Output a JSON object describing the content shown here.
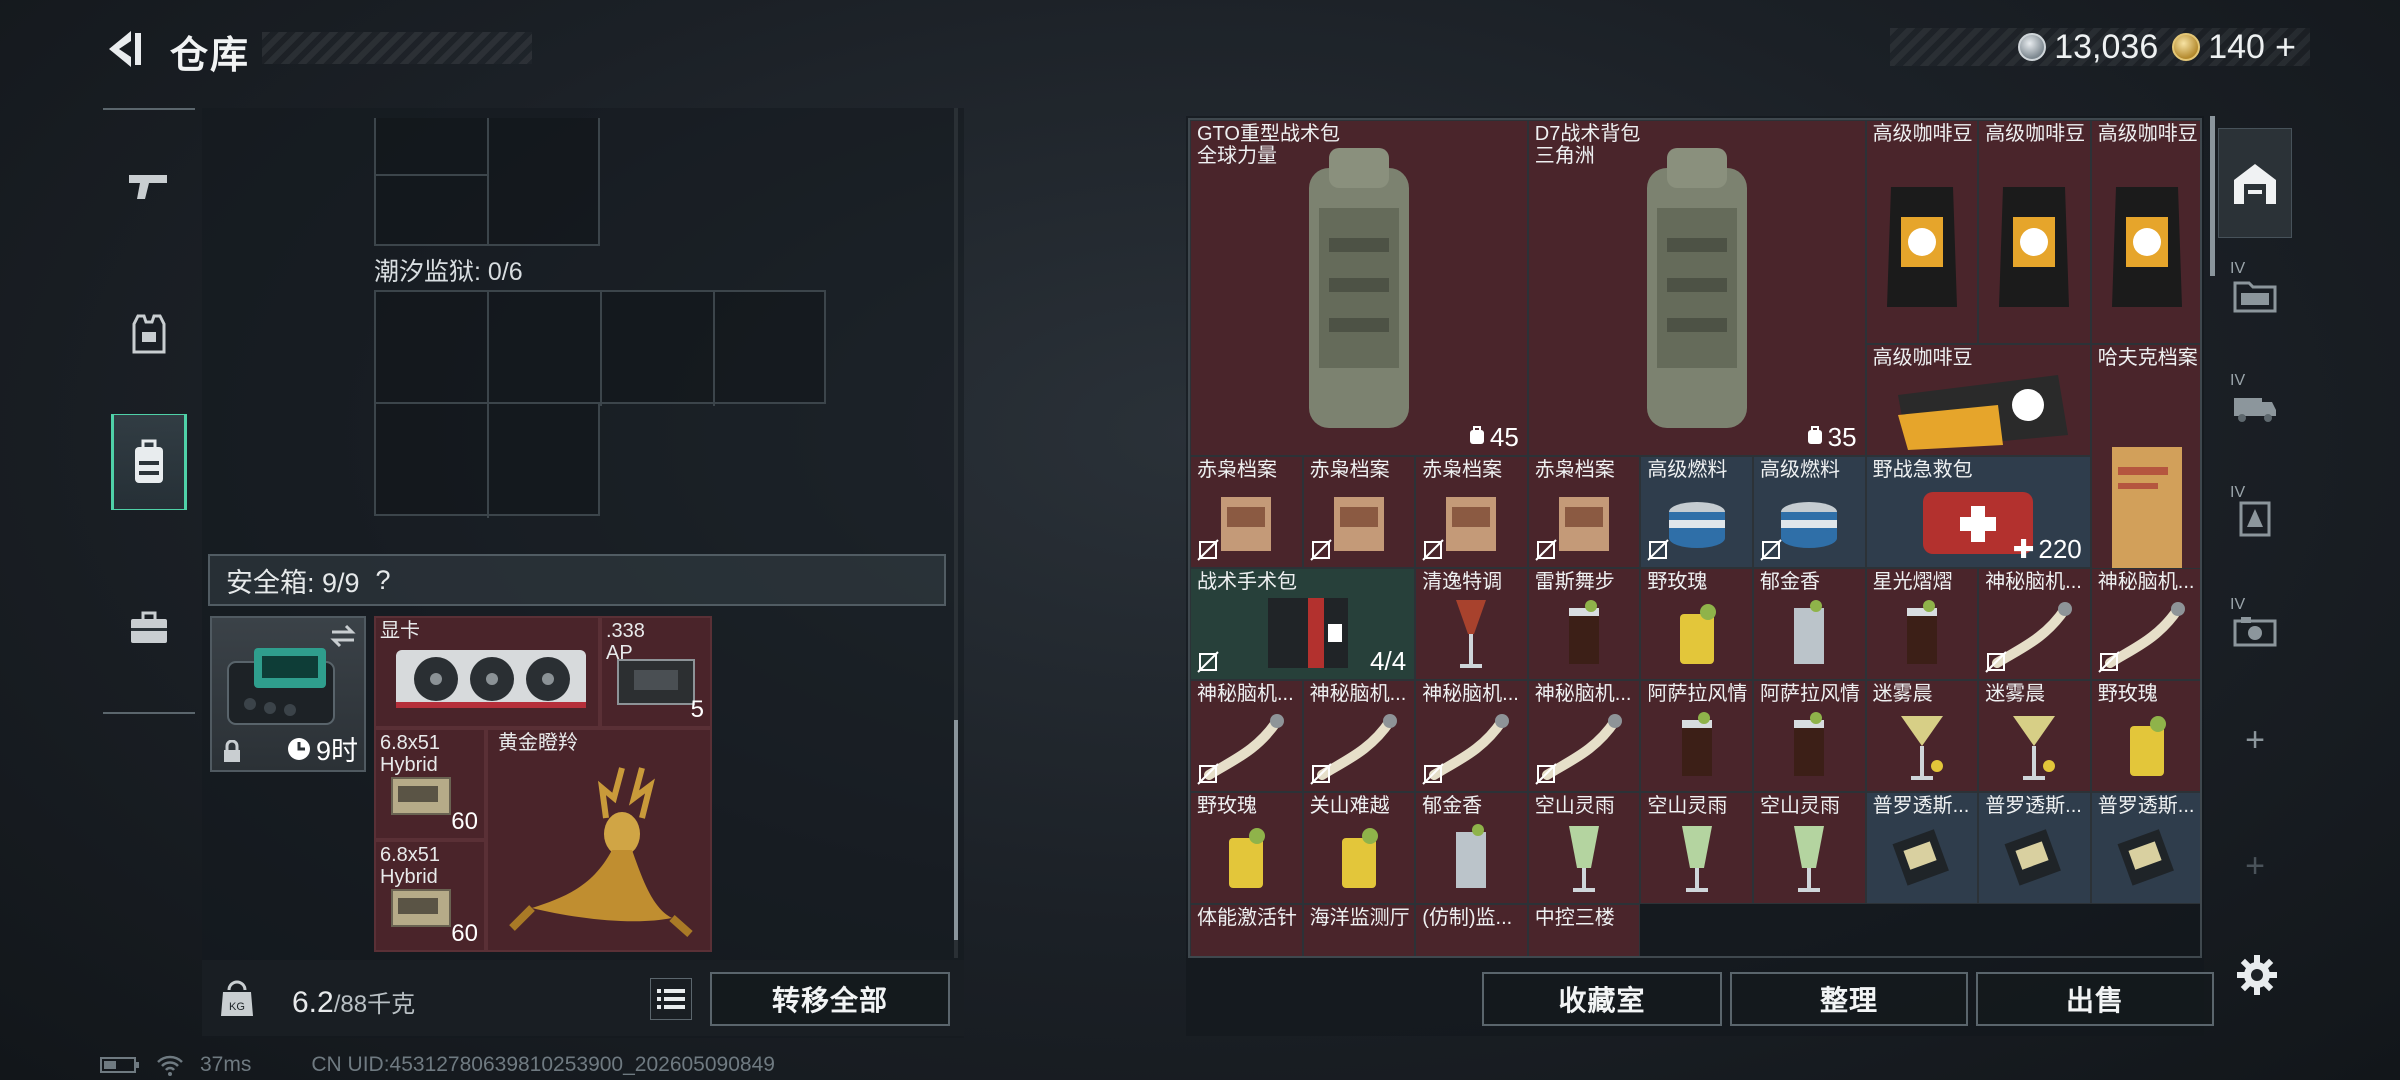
{
  "header": {
    "title": "仓库",
    "currencies": [
      {
        "icon": "silver-coin-icon",
        "amount": "13,036"
      },
      {
        "icon": "gold-coin-icon",
        "amount": "140"
      }
    ],
    "add_label": "+"
  },
  "left_nav": {
    "items": [
      {
        "icon": "pistol-icon",
        "active": false
      },
      {
        "icon": "armor-vest-icon",
        "active": false
      },
      {
        "icon": "backpack-icon",
        "active": true
      },
      {
        "icon": "briefcase-icon",
        "active": false
      }
    ]
  },
  "container": {
    "prison_label": "潮汐监狱: 0/6",
    "safe_label": "安全箱: 9/9",
    "help_label": "?",
    "safebox_time": "9时",
    "items": [
      {
        "name": "显卡",
        "sub": "",
        "count": ""
      },
      {
        "name": ".338",
        "sub": "AP",
        "count": "5"
      },
      {
        "name": "6.8x51",
        "sub": "Hybrid",
        "count": "60"
      },
      {
        "name": "黄金瞪羚",
        "sub": "",
        "count": ""
      },
      {
        "name": "6.8x51",
        "sub": "Hybrid",
        "count": "60"
      }
    ]
  },
  "weight": {
    "current": "6.2",
    "max": "/88千克"
  },
  "actions": {
    "transfer_all": "转移全部",
    "collection": "收藏室",
    "organize": "整理",
    "sell": "出售"
  },
  "status": {
    "ping": "37ms",
    "uid": "CN UID:45312780639810253900_202605090849"
  },
  "warehouse": {
    "items": [
      {
        "name": "GTO重型战术包",
        "sub": "全球力量",
        "count": "45",
        "color": "red"
      },
      {
        "name": "D7战术背包",
        "sub": "三角洲",
        "count": "35",
        "color": "red"
      },
      {
        "name": "高级咖啡豆",
        "color": "red"
      },
      {
        "name": "高级咖啡豆",
        "color": "red"
      },
      {
        "name": "高级咖啡豆",
        "color": "red"
      },
      {
        "name": "高级咖啡豆",
        "color": "red"
      },
      {
        "name": "哈夫克档案",
        "color": "red"
      },
      {
        "name": "赤枭档案",
        "color": "red"
      },
      {
        "name": "赤枭档案",
        "color": "red"
      },
      {
        "name": "赤枭档案",
        "color": "red"
      },
      {
        "name": "赤枭档案",
        "color": "red"
      },
      {
        "name": "高级燃料",
        "color": "blue"
      },
      {
        "name": "高级燃料",
        "color": "blue"
      },
      {
        "name": "野战急救包",
        "count": "220",
        "color": "blue"
      },
      {
        "name": "战术手术包",
        "count": "4/4",
        "color": "green"
      },
      {
        "name": "清逸特调",
        "color": "red"
      },
      {
        "name": "雷斯舞步",
        "color": "red"
      },
      {
        "name": "野玫瑰",
        "color": "red"
      },
      {
        "name": "郁金香",
        "color": "red"
      },
      {
        "name": "星光熠熠",
        "color": "red"
      },
      {
        "name": "神秘脑机...",
        "color": "red"
      },
      {
        "name": "神秘脑机...",
        "color": "red"
      },
      {
        "name": "神秘脑机...",
        "color": "red"
      },
      {
        "name": "神秘脑机...",
        "color": "red"
      },
      {
        "name": "神秘脑机...",
        "color": "red"
      },
      {
        "name": "神秘脑机...",
        "color": "red"
      },
      {
        "name": "阿萨拉风情",
        "color": "red"
      },
      {
        "name": "阿萨拉风情",
        "color": "red"
      },
      {
        "name": "迷雾晨",
        "color": "red"
      },
      {
        "name": "迷雾晨",
        "color": "red"
      },
      {
        "name": "野玫瑰",
        "color": "red"
      },
      {
        "name": "野玫瑰",
        "color": "red"
      },
      {
        "name": "关山难越",
        "color": "red"
      },
      {
        "name": "郁金香",
        "color": "red"
      },
      {
        "name": "空山灵雨",
        "color": "red"
      },
      {
        "name": "空山灵雨",
        "color": "red"
      },
      {
        "name": "空山灵雨",
        "color": "red"
      },
      {
        "name": "普罗透斯...",
        "color": "blue"
      },
      {
        "name": "普罗透斯...",
        "color": "blue"
      },
      {
        "name": "普罗透斯...",
        "color": "blue"
      },
      {
        "name": "体能激活针",
        "color": "red"
      },
      {
        "name": "海洋监测厅",
        "color": "red"
      },
      {
        "name": "(仿制)监...",
        "color": "red"
      },
      {
        "name": "中控三楼",
        "color": "red"
      }
    ]
  },
  "right_rail": {
    "items": [
      {
        "icon": "warehouse-icon",
        "label": ""
      },
      {
        "icon": "folder-icon",
        "label": "IV"
      },
      {
        "icon": "truck-icon",
        "label": "IV"
      },
      {
        "icon": "armor-icon",
        "label": "IV"
      },
      {
        "icon": "camera-icon",
        "label": "IV"
      },
      {
        "icon": "plus-icon",
        "label": "+"
      },
      {
        "icon": "plus-icon",
        "label": "+"
      }
    ]
  }
}
